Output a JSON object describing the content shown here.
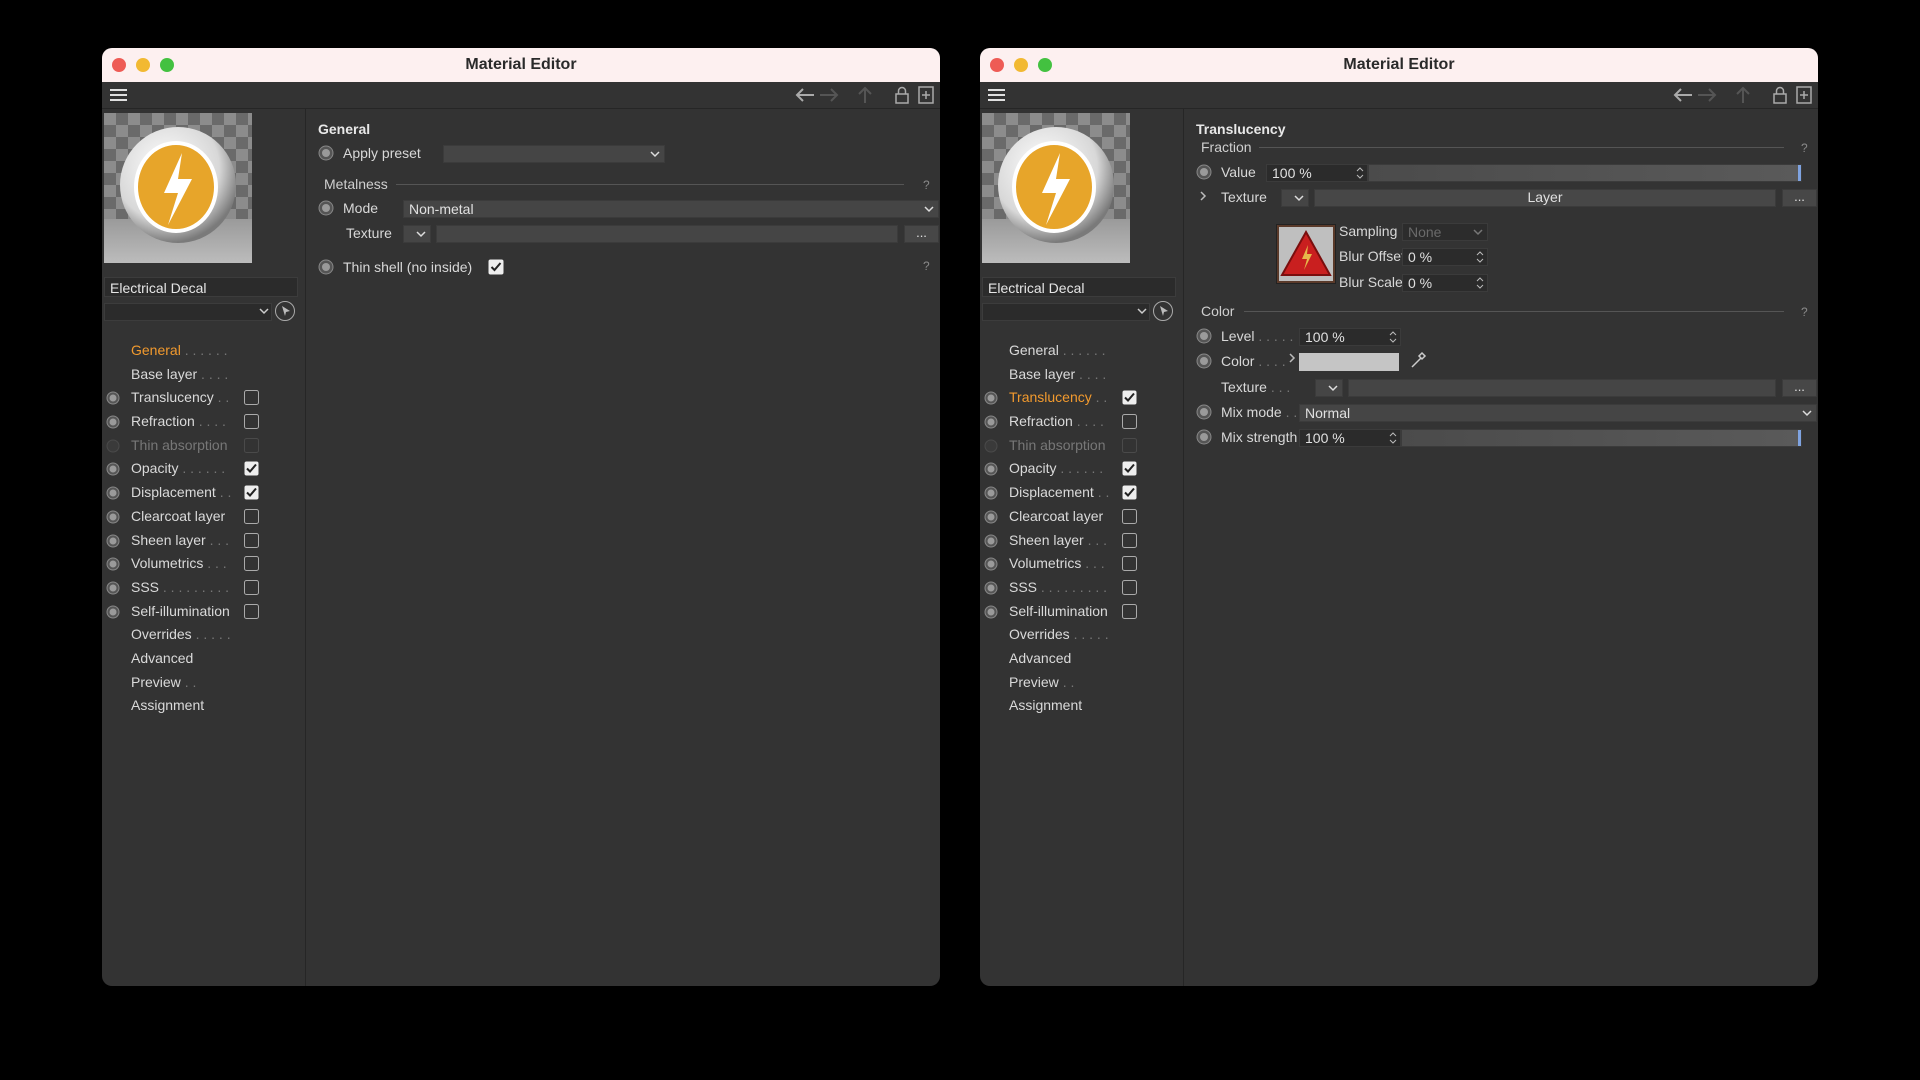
{
  "windows": [
    {
      "title": "Material Editor",
      "material_name": "Electrical Decal",
      "nav": [
        {
          "label": "General",
          "dots": ". . . . . .",
          "active": true,
          "radio": false,
          "checkbox": null,
          "dim": false
        },
        {
          "label": "Base layer",
          "dots": ". . . .",
          "active": false,
          "radio": false,
          "checkbox": null,
          "dim": false
        },
        {
          "label": "Translucency",
          "dots": ". .",
          "active": false,
          "radio": true,
          "checkbox": false,
          "dim": false
        },
        {
          "label": "Refraction",
          "dots": ". . . .",
          "active": false,
          "radio": true,
          "checkbox": false,
          "dim": false
        },
        {
          "label": "Thin absorption",
          "dots": "",
          "active": false,
          "radio": "dim",
          "checkbox": "dim",
          "dim": true
        },
        {
          "label": "Opacity",
          "dots": ". . . . . .",
          "active": false,
          "radio": true,
          "checkbox": true,
          "dim": false
        },
        {
          "label": "Displacement",
          "dots": ". .",
          "active": false,
          "radio": true,
          "checkbox": true,
          "dim": false
        },
        {
          "label": "Clearcoat layer",
          "dots": "",
          "active": false,
          "radio": true,
          "checkbox": false,
          "dim": false
        },
        {
          "label": "Sheen layer",
          "dots": ". . .",
          "active": false,
          "radio": true,
          "checkbox": false,
          "dim": false
        },
        {
          "label": "Volumetrics",
          "dots": ". . .",
          "active": false,
          "radio": true,
          "checkbox": false,
          "dim": false
        },
        {
          "label": "SSS",
          "dots": ". . . . . . . . .",
          "active": false,
          "radio": true,
          "checkbox": false,
          "dim": false
        },
        {
          "label": "Self-illumination",
          "dots": "",
          "active": false,
          "radio": true,
          "checkbox": false,
          "dim": false
        },
        {
          "label": "Overrides",
          "dots": ". . . . .",
          "active": false,
          "radio": false,
          "checkbox": null,
          "dim": false
        },
        {
          "label": "Advanced",
          "dots": "",
          "active": false,
          "radio": false,
          "checkbox": null,
          "dim": false
        },
        {
          "label": "Preview",
          "dots": ". .",
          "active": false,
          "radio": false,
          "checkbox": null,
          "dim": false
        },
        {
          "label": "Assignment",
          "dots": "",
          "active": false,
          "radio": false,
          "checkbox": null,
          "dim": false
        }
      ],
      "panel": {
        "section": "General",
        "apply_preset_label": "Apply preset",
        "apply_preset_value": "",
        "metalness_group": "Metalness",
        "mode_label": "Mode",
        "mode_value": "Non-metal",
        "texture_label": "Texture",
        "ellipsis": "...",
        "thin_shell_label": "Thin shell (no inside)",
        "thin_shell_checked": true,
        "help": "?"
      }
    },
    {
      "title": "Material Editor",
      "material_name": "Electrical Decal",
      "nav": [
        {
          "label": "General",
          "dots": ". . . . . .",
          "active": false,
          "radio": false,
          "checkbox": null,
          "dim": false
        },
        {
          "label": "Base layer",
          "dots": ". . . .",
          "active": false,
          "radio": false,
          "checkbox": null,
          "dim": false
        },
        {
          "label": "Translucency",
          "dots": ". .",
          "active": true,
          "radio": true,
          "checkbox": true,
          "dim": false
        },
        {
          "label": "Refraction",
          "dots": ". . . .",
          "active": false,
          "radio": true,
          "checkbox": false,
          "dim": false
        },
        {
          "label": "Thin absorption",
          "dots": "",
          "active": false,
          "radio": "dim",
          "checkbox": "dim",
          "dim": true
        },
        {
          "label": "Opacity",
          "dots": ". . . . . .",
          "active": false,
          "radio": true,
          "checkbox": true,
          "dim": false
        },
        {
          "label": "Displacement",
          "dots": ". .",
          "active": false,
          "radio": true,
          "checkbox": true,
          "dim": false
        },
        {
          "label": "Clearcoat layer",
          "dots": "",
          "active": false,
          "radio": true,
          "checkbox": false,
          "dim": false
        },
        {
          "label": "Sheen layer",
          "dots": ". . .",
          "active": false,
          "radio": true,
          "checkbox": false,
          "dim": false
        },
        {
          "label": "Volumetrics",
          "dots": ". . .",
          "active": false,
          "radio": true,
          "checkbox": false,
          "dim": false
        },
        {
          "label": "SSS",
          "dots": ". . . . . . . . .",
          "active": false,
          "radio": true,
          "checkbox": false,
          "dim": false
        },
        {
          "label": "Self-illumination",
          "dots": "",
          "active": false,
          "radio": true,
          "checkbox": false,
          "dim": false
        },
        {
          "label": "Overrides",
          "dots": ". . . . .",
          "active": false,
          "radio": false,
          "checkbox": null,
          "dim": false
        },
        {
          "label": "Advanced",
          "dots": "",
          "active": false,
          "radio": false,
          "checkbox": null,
          "dim": false
        },
        {
          "label": "Preview",
          "dots": ". .",
          "active": false,
          "radio": false,
          "checkbox": null,
          "dim": false
        },
        {
          "label": "Assignment",
          "dots": "",
          "active": false,
          "radio": false,
          "checkbox": null,
          "dim": false
        }
      ],
      "panel": {
        "section": "Translucency",
        "fraction_group": "Fraction",
        "value_label": "Value",
        "value_value": "100 %",
        "value_fraction": 1.0,
        "texture_label": "Texture",
        "layer_button": "Layer",
        "ellipsis": "...",
        "sampling_label": "Sampling",
        "sampling_value": "None",
        "blur_offset_label": "Blur Offset",
        "blur_offset_value": "0 %",
        "blur_scale_label": "Blur Scale",
        "blur_scale_value": "0 %",
        "color_group": "Color",
        "level_label": "Level",
        "level_dots": ". . . . .",
        "level_value": "100 %",
        "color_label": "Color",
        "color_dots": ". . . .",
        "color_swatch": "#c5c5c5",
        "texture2_label": "Texture",
        "texture2_dots": ". . .",
        "mix_mode_label": "Mix mode",
        "mix_mode_dots": ". .",
        "mix_mode_value": "Normal",
        "mix_strength_label": "Mix strength",
        "mix_strength_value": "100 %",
        "mix_strength_fraction": 1.0,
        "help": "?"
      }
    }
  ],
  "colors": {
    "accent_orange": "#f29a2e",
    "slider_knob": "#7fa3e0"
  }
}
